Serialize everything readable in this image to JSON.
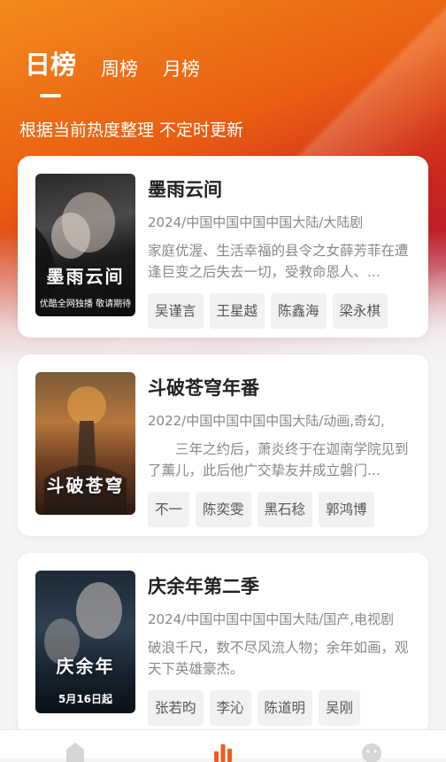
{
  "tabs": [
    {
      "label": "日榜",
      "active": true
    },
    {
      "label": "周榜",
      "active": false
    },
    {
      "label": "月榜",
      "active": false
    }
  ],
  "subtitle": "根据当前热度整理 不定时更新",
  "cards": [
    {
      "title": "墨雨云间",
      "meta": "2024/中国中国中国中国大陆/大陆剧",
      "desc": "家庭优渥、生活幸福的县令之女薛芳菲在遭逢巨变之后失去一切，受救命恩人、...",
      "actors": [
        "吴谨言",
        "王星越",
        "陈鑫海",
        "梁永棋"
      ],
      "poster_text": "墨雨云间",
      "poster_foot": "优酷全网独播 敬请期待"
    },
    {
      "title": "斗破苍穹年番",
      "meta": "2022/中国中国中国中国大陆/动画,奇幻,",
      "desc": "　　三年之约后，萧炎终于在迦南学院见到了薰儿，此后他广交挚友并成立磐门...",
      "actors": [
        "不一",
        "陈奕雯",
        "黑石稔",
        "郭鸿博"
      ],
      "poster_text": "斗破苍穹",
      "poster_foot": ""
    },
    {
      "title": "庆余年第二季",
      "meta": "2024/中国中国中国中国大陆/国产,电视剧",
      "desc": "破浪千尺，数不尽风流人物；余年如画，观天下英雄豪杰。",
      "actors": [
        "张若昀",
        "李沁",
        "陈道明",
        "吴刚"
      ],
      "poster_text": "庆余年",
      "poster_foot": "5月16日起"
    }
  ],
  "nav": [
    "home-icon",
    "chart-icon",
    "face-icon"
  ],
  "colors": {
    "accent": "#ef5a24",
    "hero_top": "#f28a1c",
    "hero_mid": "#c9281f"
  }
}
